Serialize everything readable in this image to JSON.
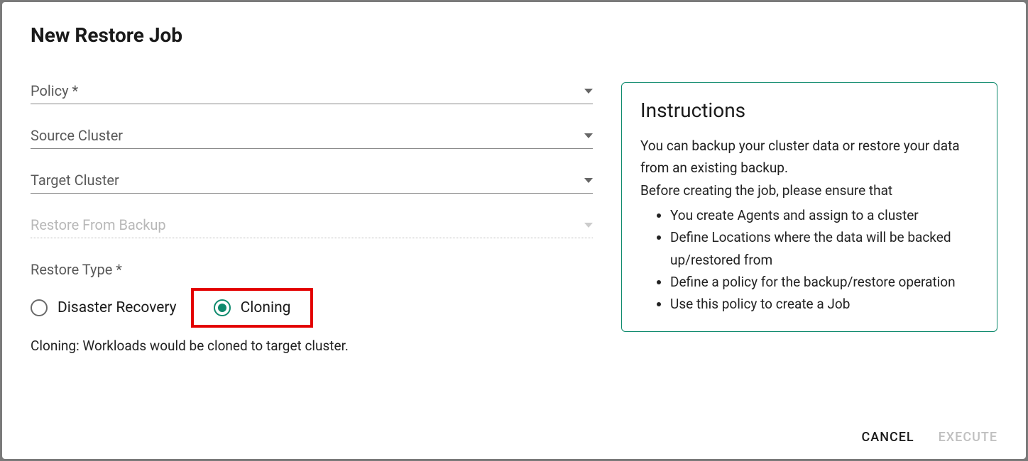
{
  "dialog": {
    "title": "New Restore Job"
  },
  "form": {
    "policy_label": "Policy *",
    "source_cluster_label": "Source Cluster",
    "target_cluster_label": "Target Cluster",
    "restore_from_backup_label": "Restore From Backup",
    "restore_type_label": "Restore Type *",
    "option_disaster_recovery": "Disaster Recovery",
    "option_cloning": "Cloning",
    "restore_type_desc": "Cloning: Workloads would be cloned to target cluster."
  },
  "instructions": {
    "title": "Instructions",
    "text1": "You can backup your cluster data or restore your data from an existing backup.",
    "text2": "Before creating the job, please ensure that",
    "bullets": [
      "You create Agents and assign to a cluster",
      "Define Locations where the data will be backed up/restored from",
      "Define a policy for the backup/restore operation",
      "Use this policy to create a Job"
    ]
  },
  "footer": {
    "cancel": "CANCEL",
    "execute": "EXECUTE"
  }
}
